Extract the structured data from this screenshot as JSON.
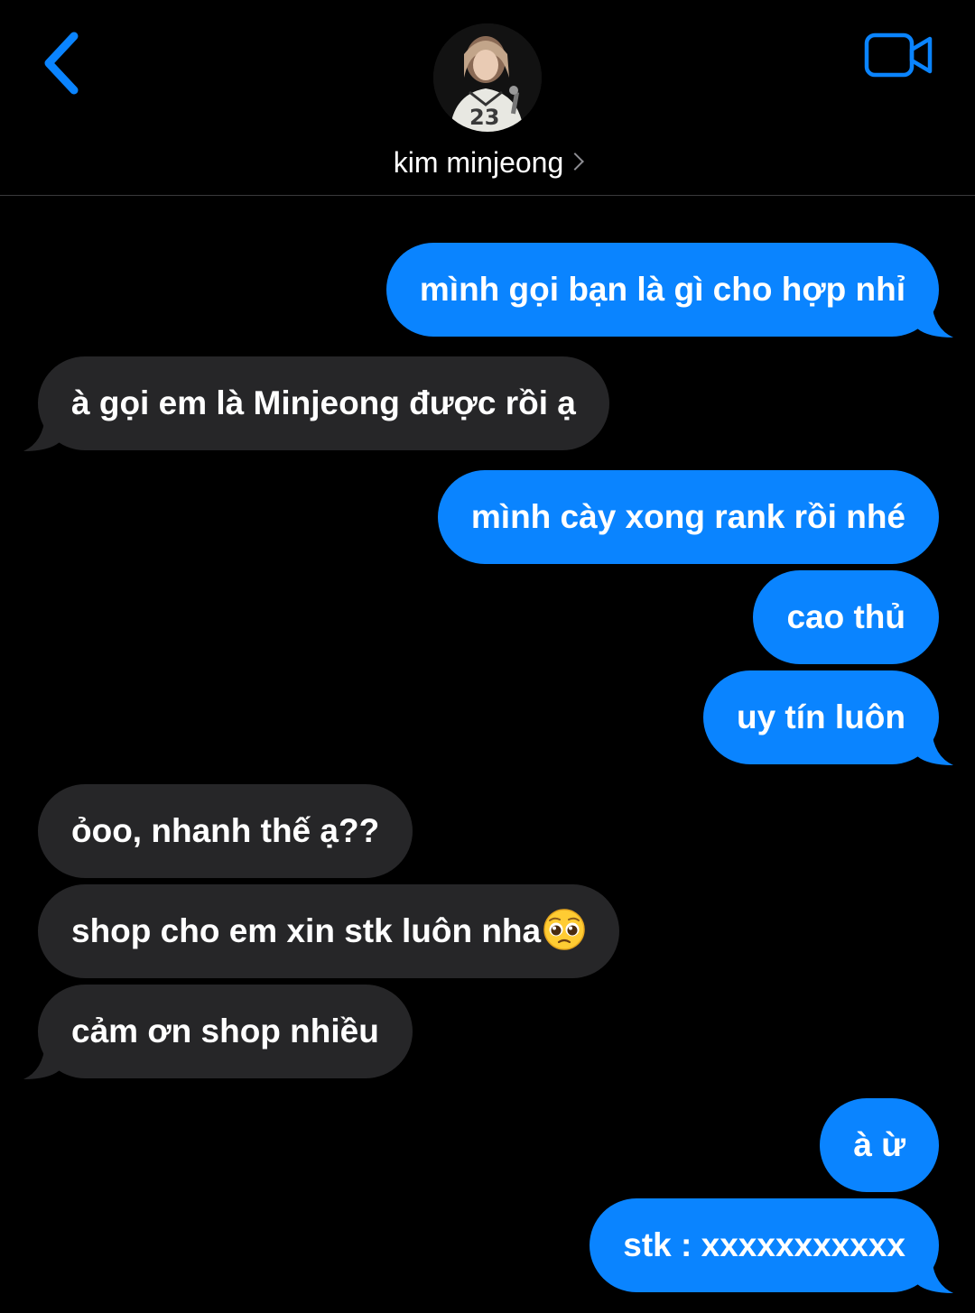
{
  "header": {
    "contact_name": "kim minjeong",
    "avatar_icon": "avatar-photo",
    "back_icon": "chevron-left-icon",
    "video_icon": "video-camera-icon",
    "accent_color": "#0a84ff"
  },
  "messages": [
    {
      "direction": "outgoing",
      "text": "mình gọi bạn là gì cho hợp nhỉ"
    },
    {
      "direction": "incoming",
      "text": "à gọi em là Minjeong được rồi ạ"
    },
    {
      "direction": "outgoing",
      "text": "mình cày xong rank rồi nhé"
    },
    {
      "direction": "outgoing",
      "text": "cao thủ"
    },
    {
      "direction": "outgoing",
      "text": "uy tín luôn"
    },
    {
      "direction": "incoming",
      "text": "ỏoo, nhanh thế ạ??"
    },
    {
      "direction": "incoming",
      "text": "shop cho em xin stk luôn nha",
      "emoji": "pleading-face-emoji"
    },
    {
      "direction": "incoming",
      "text": "cảm ơn shop nhiều"
    },
    {
      "direction": "outgoing",
      "text": "à ừ"
    },
    {
      "direction": "outgoing",
      "text": "stk : xxxxxxxxxxx"
    }
  ],
  "colors": {
    "outgoing_bubble": "#0a84ff",
    "incoming_bubble": "#262628",
    "background": "#000000"
  }
}
